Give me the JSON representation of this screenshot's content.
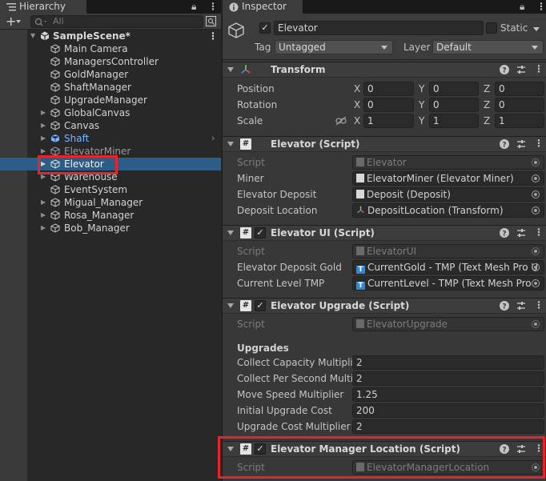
{
  "hierarchy": {
    "tab_label": "Hierarchy",
    "search_placeholder": "All",
    "items": [
      {
        "label": "SampleScene*"
      },
      {
        "label": "Main Camera"
      },
      {
        "label": "ManagersController"
      },
      {
        "label": "GoldManager"
      },
      {
        "label": "ShaftManager"
      },
      {
        "label": "UpgradeManager"
      },
      {
        "label": "GlobalCanvas"
      },
      {
        "label": "Canvas"
      },
      {
        "label": "Shaft"
      },
      {
        "label": "ElevatorMiner"
      },
      {
        "label": "Elevator"
      },
      {
        "label": "Warehouse"
      },
      {
        "label": "EventSystem"
      },
      {
        "label": "Migual_Manager"
      },
      {
        "label": "Rosa_Manager"
      },
      {
        "label": "Bob_Manager"
      }
    ]
  },
  "inspector": {
    "tab_label": "Inspector",
    "object_name": "Elevator",
    "static_label": "Static",
    "tag_label": "Tag",
    "tag_value": "Untagged",
    "layer_label": "Layer",
    "layer_value": "Default",
    "transform": {
      "title": "Transform",
      "position_label": "Position",
      "rotation_label": "Rotation",
      "scale_label": "Scale",
      "x": "X",
      "y": "Y",
      "z": "Z",
      "position": [
        "0",
        "0",
        "0"
      ],
      "rotation": [
        "0",
        "0",
        "0"
      ],
      "scale": [
        "1",
        "1",
        "1"
      ]
    },
    "elevator_script": {
      "title": "Elevator (Script)",
      "script_label": "Script",
      "script_value": "Elevator",
      "miner_label": "Miner",
      "miner_value": "ElevatorMiner (Elevator Miner)",
      "deposit_label": "Elevator Deposit",
      "deposit_value": "Deposit (Deposit)",
      "location_label": "Deposit Location",
      "location_value": "DepositLocation (Transform)"
    },
    "elevator_ui": {
      "title": "Elevator UI (Script)",
      "script_label": "Script",
      "script_value": "ElevatorUI",
      "gold_label": "Elevator Deposit Gold",
      "gold_value": "CurrentGold - TMP (Text Mesh Pro U",
      "level_label": "Current Level TMP",
      "level_value": "CurrentLevel - TMP (Text Mesh Pro"
    },
    "elevator_upgrade": {
      "title": "Elevator Upgrade (Script)",
      "script_label": "Script",
      "script_value": "ElevatorUpgrade",
      "upgrades_heading": "Upgrades",
      "collect_capacity_label": "Collect Capacity Multiplie",
      "collect_capacity_value": "2",
      "collect_per_second_label": "Collect Per Second Multi",
      "collect_per_second_value": "2",
      "move_speed_label": "Move Speed Multiplier",
      "move_speed_value": "1.25",
      "initial_cost_label": "Initial Upgrade Cost",
      "initial_cost_value": "200",
      "cost_multiplier_label": "Upgrade Cost Multiplier",
      "cost_multiplier_value": "2"
    },
    "elevator_manager_location": {
      "title": "Elevator Manager Location (Script)",
      "script_label": "Script",
      "script_value": "ElevatorManagerLocation"
    }
  },
  "colors": {
    "selection": "#2c5d87",
    "highlight_box": "#e8242a",
    "prefab_text": "#7cb3ff"
  }
}
